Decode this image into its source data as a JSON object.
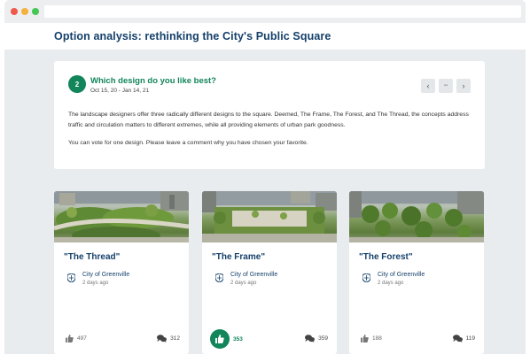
{
  "page": {
    "title": "Option analysis: rethinking the City's Public Square"
  },
  "question": {
    "step": "2",
    "title": "Which design do you like best?",
    "dates": "Oct 15, 20 - Jan 14, 21",
    "description": "The landscape designers offer three radically different designs to the square. Deemed, The Frame, The Forest, and The Thread, the concepts address traffic and circulation matters to different extremes, while all providing elements of urban park goodness.",
    "note": "You can vote for one design. Please leave a comment why you have chosen your favorite.",
    "nav": {
      "prev": "‹",
      "grid": "▪▪",
      "next": "›"
    }
  },
  "options": [
    {
      "title": "\"The Thread\"",
      "author": "City of Greenville",
      "time": "2 days ago",
      "likes": "497",
      "comments": "312",
      "liked": false
    },
    {
      "title": "\"The Frame\"",
      "author": "City of Greenville",
      "time": "2 days ago",
      "likes": "353",
      "comments": "359",
      "liked": true
    },
    {
      "title": "\"The Forest\"",
      "author": "City of Greenville",
      "time": "2 days ago",
      "likes": "188",
      "comments": "119",
      "liked": false
    }
  ],
  "colors": {
    "brand_green": "#12855a",
    "title_navy": "#15406b",
    "page_background": "#e8ecee"
  },
  "icons": [
    "shield-icon",
    "thumbs-up-icon",
    "comments-icon",
    "chevron-left-icon",
    "chevron-right-icon",
    "grid-icon"
  ]
}
